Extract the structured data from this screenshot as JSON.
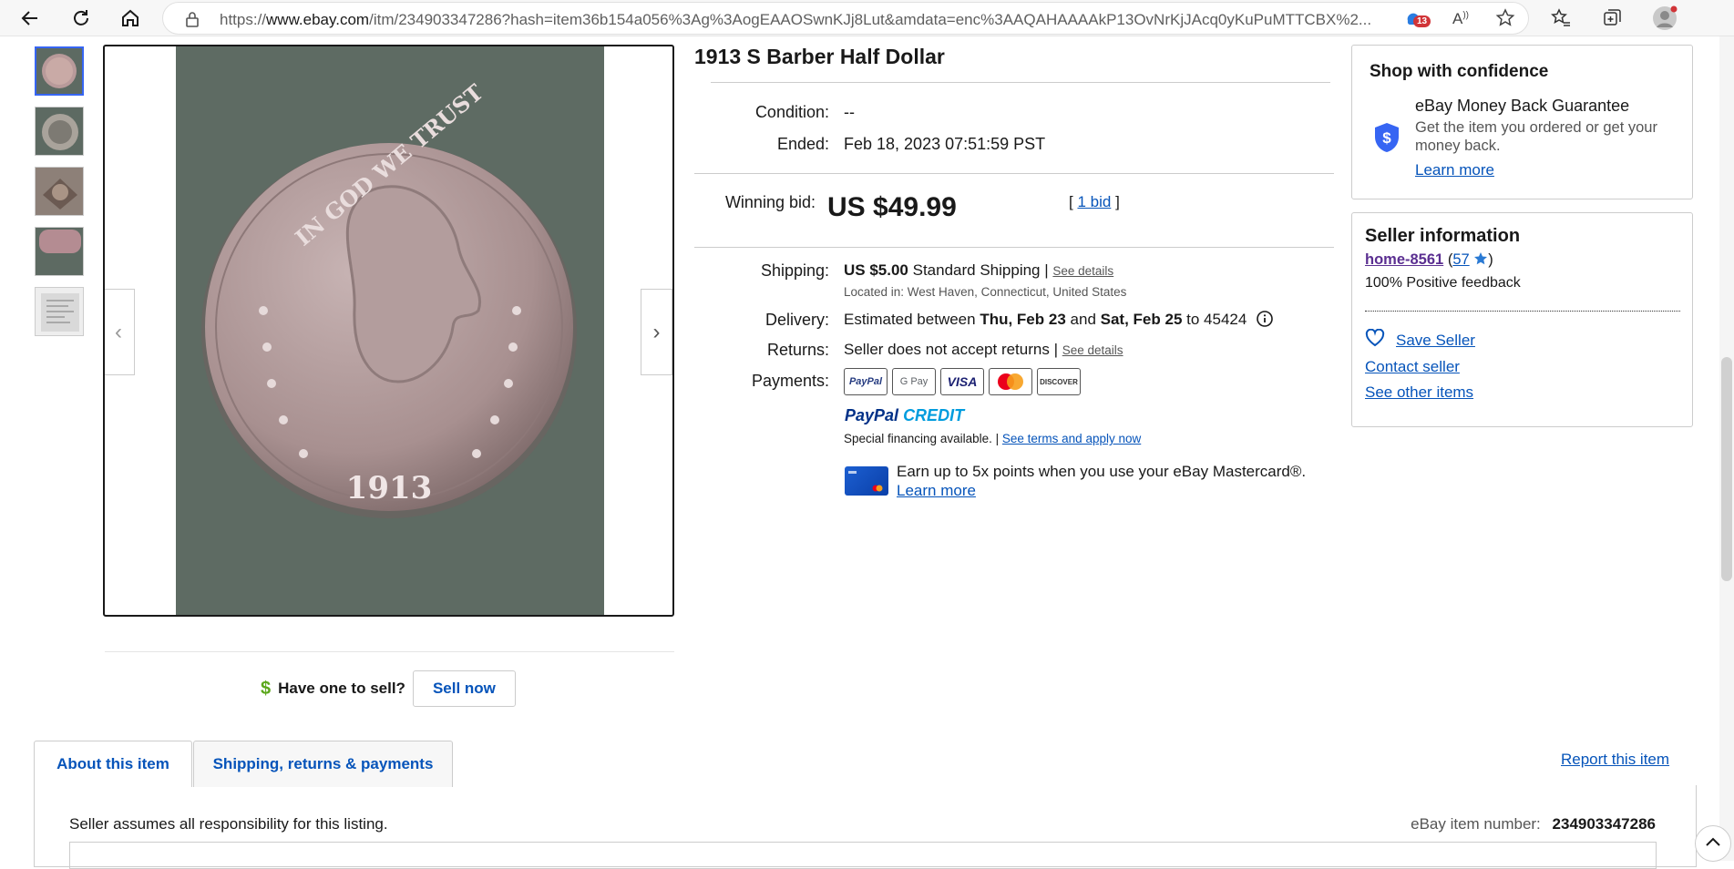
{
  "browser": {
    "url_prefix": "https://",
    "url_domain": "www.ebay.com",
    "url_rest": "/itm/234903347286?hash=item36b154a056%3Ag%3AogEAAOSwnKJj8Lut&amdata=enc%3AAQAHAAAAkP13OvNrKjJAcq0yKuPuMTTCBX%2...",
    "notification_count": "13"
  },
  "listing": {
    "title": "1913 S Barber Half Dollar",
    "condition_label": "Condition:",
    "condition_value": "--",
    "ended_label": "Ended:",
    "ended_value": "Feb 18, 2023 07:51:59 PST",
    "winning_bid_label": "Winning bid:",
    "winning_bid_value": "US $49.99",
    "bid_open": "[",
    "bid_link": "1 bid",
    "bid_close": "]",
    "shipping_label": "Shipping:",
    "shipping_price": "US $5.00",
    "shipping_method": "Standard Shipping |",
    "shipping_details_link": "See details",
    "located_in": "Located in: West Haven, Connecticut, United States",
    "delivery_label": "Delivery:",
    "delivery_prefix": "Estimated between",
    "delivery_start": "Thu, Feb 23",
    "delivery_and": "and",
    "delivery_end": "Sat, Feb 25",
    "delivery_suffix": "to 45424",
    "returns_label": "Returns:",
    "returns_value": "Seller does not accept returns |",
    "returns_details_link": "See details",
    "payments_label": "Payments:",
    "payment_methods": [
      "PayPal",
      "G Pay",
      "VISA",
      "Mastercard",
      "DISCOVER"
    ],
    "paypal_credit_word1": "PayPal",
    "paypal_credit_word2": "CREDIT",
    "financing_text": "Special financing available. |",
    "financing_link": "See terms and apply now",
    "mastercard_offer": "Earn up to 5x points when you use your eBay Mastercard®.",
    "mastercard_learn_more": "Learn more"
  },
  "sell": {
    "prompt": "Have one to sell?",
    "button": "Sell now"
  },
  "confidence": {
    "title": "Shop with confidence",
    "guarantee_title": "eBay Money Back Guarantee",
    "guarantee_text": "Get the item you ordered or get your money back.",
    "learn_more": "Learn more"
  },
  "seller": {
    "title": "Seller information",
    "name": "home-8561",
    "open_paren": "(",
    "feedback_count": "57",
    "close_paren": ")",
    "positive_feedback": "100% Positive feedback",
    "save_seller": "Save Seller",
    "contact_seller": "Contact seller",
    "see_other_items": "See other items"
  },
  "tabs": {
    "about": "About this item",
    "shipping": "Shipping, returns & payments",
    "report": "Report this item"
  },
  "about": {
    "responsibility": "Seller assumes all responsibility for this listing.",
    "item_number_label": "eBay item number:",
    "item_number": "234903347286"
  },
  "coin": {
    "year": "1913",
    "motto": "IN GOD WE TRUST"
  },
  "colors": {
    "link": "#0654ba",
    "accent_blue": "#3665f3",
    "seller_link": "#5b2f91"
  }
}
